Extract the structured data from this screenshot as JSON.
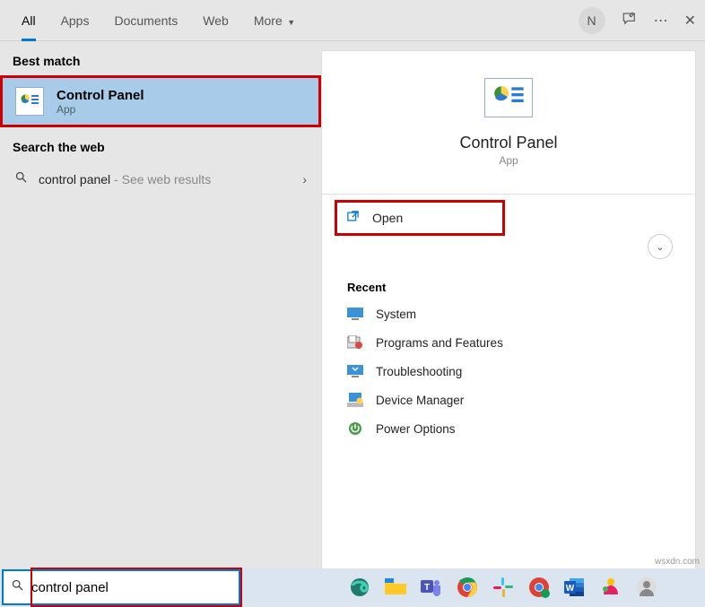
{
  "tabs": {
    "all": "All",
    "apps": "Apps",
    "documents": "Documents",
    "web": "Web",
    "more": "More"
  },
  "header": {
    "avatar_letter": "N"
  },
  "left": {
    "best_match_label": "Best match",
    "best_match": {
      "title": "Control Panel",
      "subtitle": "App"
    },
    "search_web_label": "Search the web",
    "web": {
      "query": "control panel",
      "hint": " - See web results"
    }
  },
  "right": {
    "title": "Control Panel",
    "subtitle": "App",
    "open": "Open",
    "recent_label": "Recent",
    "recent": [
      {
        "label": "System"
      },
      {
        "label": "Programs and Features"
      },
      {
        "label": "Troubleshooting"
      },
      {
        "label": "Device Manager"
      },
      {
        "label": "Power Options"
      }
    ]
  },
  "search": {
    "value": "control panel"
  },
  "watermark": "wsxdn.com"
}
